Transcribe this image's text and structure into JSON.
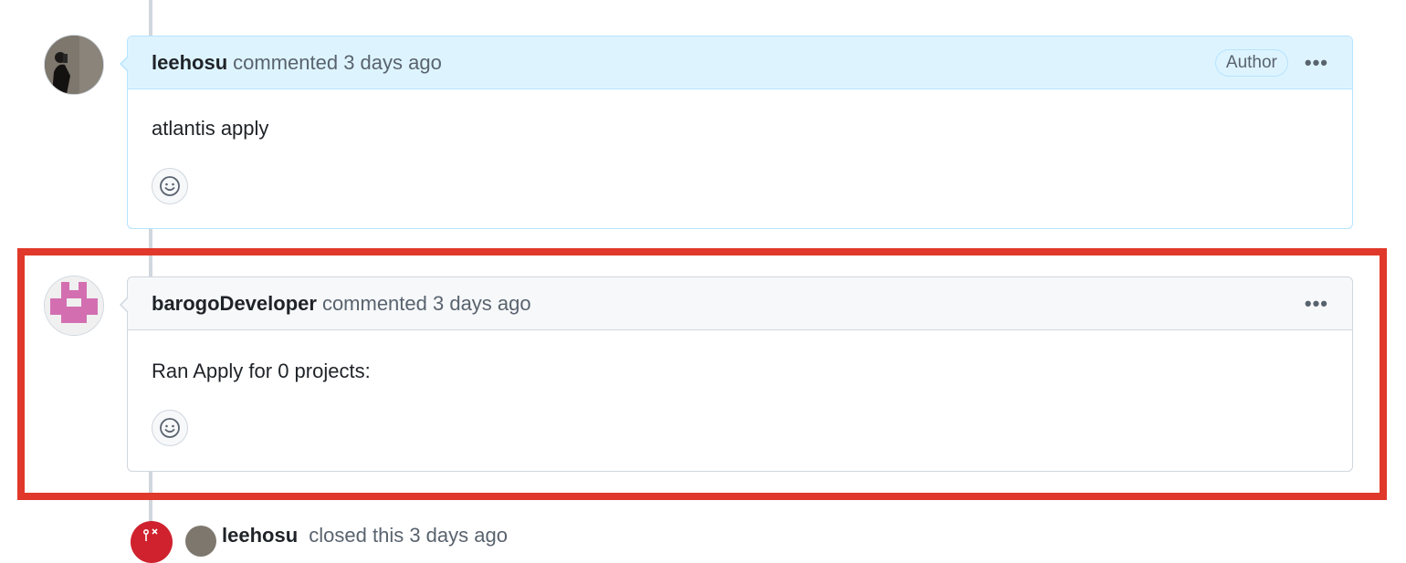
{
  "comments": [
    {
      "username": "leehosu",
      "action": "commented 3 days ago",
      "badge": "Author",
      "body": "atlantis apply",
      "menu_icon": "kebab-horizontal-icon",
      "reaction_icon": "smiley-icon"
    },
    {
      "username": "barogoDeveloper",
      "action": "commented 3 days ago",
      "body": "Ran Apply for 0 projects:",
      "menu_icon": "kebab-horizontal-icon",
      "reaction_icon": "smiley-icon"
    }
  ],
  "event": {
    "username": "leehosu",
    "action": "closed this 3 days ago",
    "icon": "git-pull-request-closed-icon"
  },
  "colors": {
    "highlight": "#e0382a",
    "author_header": "#ddf4ff",
    "closed": "#cf222e",
    "identicon": "#d36fb1"
  }
}
